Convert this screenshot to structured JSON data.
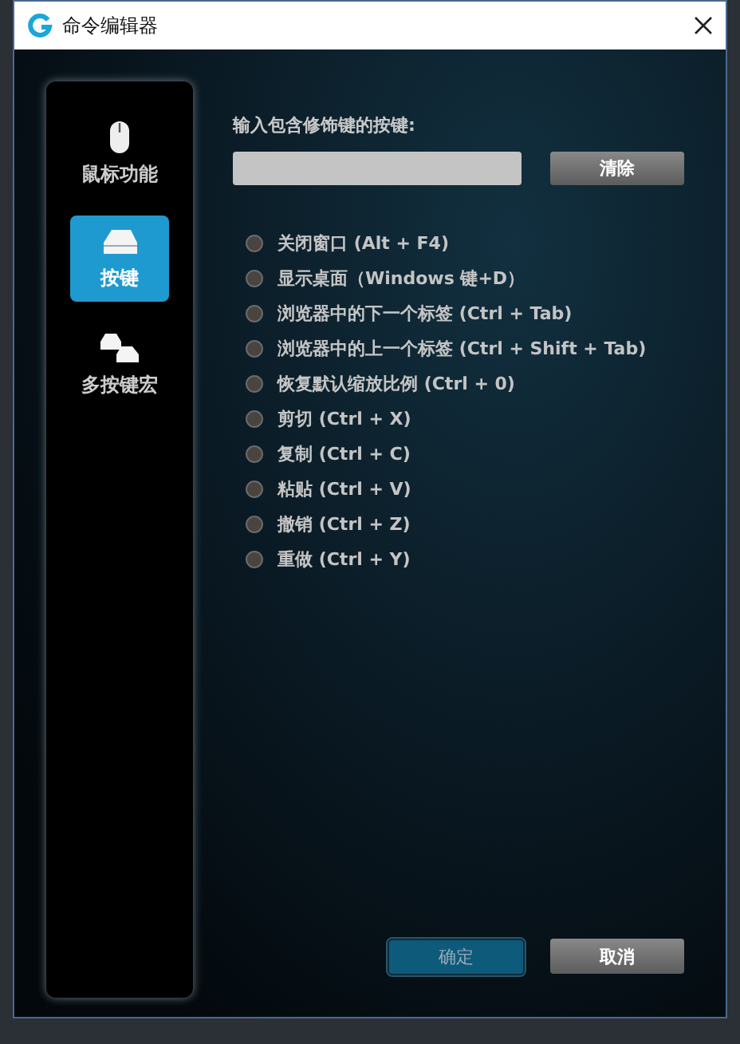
{
  "window": {
    "title": "命令编辑器"
  },
  "sidebar": {
    "items": [
      {
        "label": "鼠标功能",
        "kind": "mouse",
        "selected": false
      },
      {
        "label": "按键",
        "kind": "key",
        "selected": true
      },
      {
        "label": "多按键宏",
        "kind": "macro",
        "selected": false
      }
    ]
  },
  "keystroke": {
    "label": "输入包含修饰键的按键:",
    "clear_button": "清除"
  },
  "presets": [
    {
      "label": "关闭窗口 (Alt + F4)",
      "selected": false
    },
    {
      "label": "显示桌面（Windows 键+D）",
      "selected": false
    },
    {
      "label": "浏览器中的下一个标签 (Ctrl + Tab)",
      "selected": false
    },
    {
      "label": "浏览器中的上一个标签 (Ctrl + Shift + Tab)",
      "selected": false
    },
    {
      "label": "恢复默认缩放比例 (Ctrl + 0)",
      "selected": false
    },
    {
      "label": "剪切 (Ctrl + X)",
      "selected": false
    },
    {
      "label": "复制 (Ctrl + C)",
      "selected": false
    },
    {
      "label": "粘贴 (Ctrl + V)",
      "selected": false
    },
    {
      "label": "撤销 (Ctrl + Z)",
      "selected": false
    },
    {
      "label": "重做 (Ctrl + Y)",
      "selected": false
    }
  ],
  "buttons": [
    {
      "label": "确定",
      "kind": "primary"
    },
    {
      "label": "取消",
      "kind": "secondary"
    }
  ]
}
